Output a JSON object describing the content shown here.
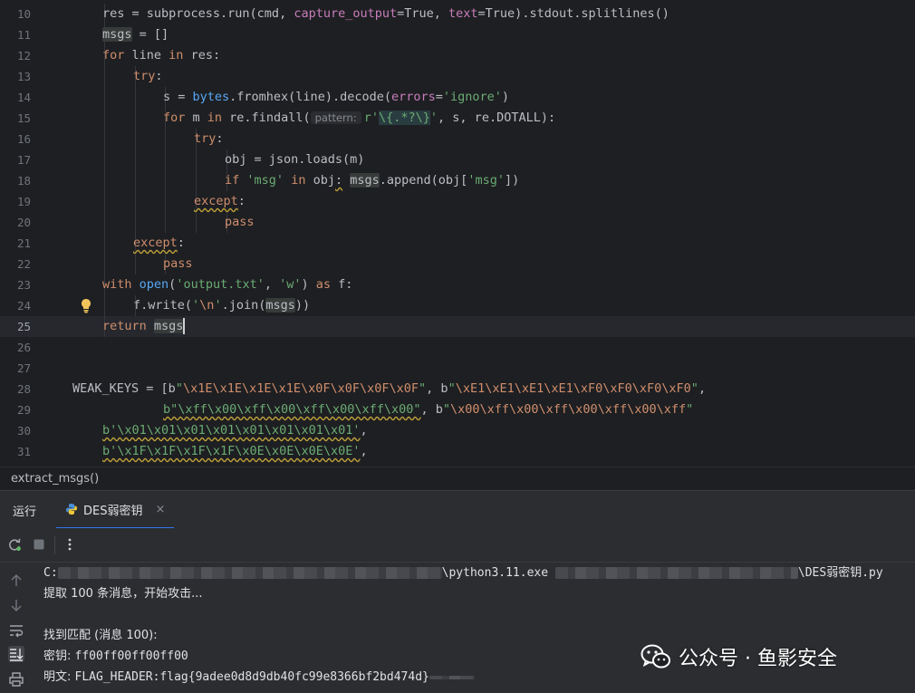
{
  "editor": {
    "lines": [
      {
        "n": "10",
        "parts": [
          [
            "",
            "res = subprocess.run(cmd, "
          ],
          [
            "param",
            "capture_output"
          ],
          [
            "",
            "=True, "
          ],
          [
            "param",
            "text"
          ],
          [
            "",
            "=True).stdout.splitlines()"
          ]
        ]
      },
      {
        "n": "11",
        "parts": [
          [
            "hl",
            "msgs"
          ],
          [
            "",
            " = []"
          ]
        ]
      },
      {
        "n": "12",
        "parts": [
          [
            "kw",
            "for"
          ],
          [
            "",
            " line "
          ],
          [
            "kw",
            "in"
          ],
          [
            "",
            " res:"
          ]
        ]
      },
      {
        "n": "13",
        "parts": [
          [
            "kw",
            "try"
          ],
          [
            "",
            ":"
          ]
        ]
      },
      {
        "n": "14",
        "parts": [
          [
            "",
            "s = "
          ],
          [
            "builtin",
            "bytes"
          ],
          [
            "",
            ".fromhex(line).decode("
          ],
          [
            "param",
            "errors"
          ],
          [
            "",
            "="
          ],
          [
            "str",
            "'ignore'"
          ],
          [
            "",
            ")"
          ]
        ]
      },
      {
        "n": "15",
        "parts": [
          [
            "kw",
            "for"
          ],
          [
            "",
            " m "
          ],
          [
            "kw",
            "in"
          ],
          [
            "",
            " re.findall("
          ],
          [
            "hint",
            "pattern:"
          ],
          [
            "str",
            "r'"
          ],
          [
            "rx",
            "\\{.*?\\}"
          ],
          [
            "str",
            "'"
          ],
          [
            "",
            ", s, re.DOTALL):"
          ]
        ]
      },
      {
        "n": "16",
        "parts": [
          [
            "kw",
            "try"
          ],
          [
            "",
            ":"
          ]
        ]
      },
      {
        "n": "17",
        "parts": [
          [
            "",
            "obj = json.loads(m)"
          ]
        ]
      },
      {
        "n": "18",
        "parts": [
          [
            "kw",
            "if"
          ],
          [
            "",
            " "
          ],
          [
            "str",
            "'msg'"
          ],
          [
            "",
            " "
          ],
          [
            "kw",
            "in"
          ],
          [
            "",
            " obj"
          ],
          [
            "underl",
            ":"
          ],
          [
            "",
            " "
          ],
          [
            "hl",
            "msgs"
          ],
          [
            "",
            ".append(obj["
          ],
          [
            "str",
            "'msg'"
          ],
          [
            "",
            "])"
          ]
        ]
      },
      {
        "n": "19",
        "parts": [
          [
            "kwu",
            "except"
          ],
          [
            "",
            ":"
          ]
        ]
      },
      {
        "n": "20",
        "parts": [
          [
            "kw",
            "pass"
          ]
        ]
      },
      {
        "n": "21",
        "parts": [
          [
            "kwu",
            "except"
          ],
          [
            "",
            ":"
          ]
        ]
      },
      {
        "n": "22",
        "parts": [
          [
            "kw",
            "pass"
          ]
        ]
      },
      {
        "n": "23",
        "parts": [
          [
            "kw",
            "with"
          ],
          [
            "",
            " "
          ],
          [
            "builtin",
            "open"
          ],
          [
            "",
            "("
          ],
          [
            "str",
            "'output.txt'"
          ],
          [
            "",
            ", "
          ],
          [
            "str",
            "'w'"
          ],
          [
            "",
            ") "
          ],
          [
            "kw",
            "as"
          ],
          [
            "",
            " f:"
          ]
        ]
      },
      {
        "n": "24",
        "parts": [
          [
            "",
            "f.write("
          ],
          [
            "str",
            "'"
          ],
          [
            "esc",
            "\\n"
          ],
          [
            "str",
            "'"
          ],
          [
            "",
            ".join("
          ],
          [
            "hl",
            "msgs"
          ],
          [
            "",
            "))"
          ]
        ]
      },
      {
        "n": "25",
        "parts": [
          [
            "kw",
            "return"
          ],
          [
            "",
            " "
          ],
          [
            "hl",
            "msgs"
          ]
        ]
      },
      {
        "n": "26",
        "parts": []
      },
      {
        "n": "27",
        "parts": []
      },
      {
        "n": "28",
        "parts": [
          [
            "",
            "WEAK_KEYS = [b"
          ],
          [
            "str",
            "\""
          ],
          [
            "esc",
            "\\x1E\\x1E\\x1E\\x1E\\x0F\\x0F\\x0F\\x0F"
          ],
          [
            "str",
            "\""
          ],
          [
            "",
            ", b"
          ],
          [
            "str",
            "\""
          ],
          [
            "esc",
            "\\xE1\\xE1\\xE1\\xE1\\xF0\\xF0\\xF0\\xF0"
          ],
          [
            "str",
            "\""
          ],
          [
            "",
            ","
          ]
        ]
      },
      {
        "n": "29",
        "parts": [
          [
            "stru",
            "b\"\\xff\\x00\\xff\\x00\\xff\\x00\\xff\\x00\""
          ],
          [
            "",
            ", b"
          ],
          [
            "str",
            "\""
          ],
          [
            "esc",
            "\\x00\\xff\\x00\\xff\\x00\\xff\\x00\\xff"
          ],
          [
            "str",
            "\""
          ]
        ]
      },
      {
        "n": "30",
        "parts": [
          [
            "stru",
            "b'\\x01\\x01\\x01\\x01\\x01\\x01\\x01\\x01'"
          ],
          [
            "",
            ","
          ]
        ]
      },
      {
        "n": "31",
        "parts": [
          [
            "stru",
            "b'\\x1F\\x1F\\x1F\\x1F\\x0E\\x0E\\x0E\\x0E'"
          ],
          [
            "",
            ","
          ]
        ]
      }
    ]
  },
  "breadcrumb": "extract_msgs()",
  "run_panel": {
    "title": "运行",
    "tab_label": "DES弱密钥",
    "close_glyph": "×"
  },
  "console": {
    "line1_prefix": "C:",
    "line1_mid": "\\python3.11.exe",
    "line1_end": "\\DES弱密钥.py",
    "line2": "提取 100 条消息，开始攻击...",
    "line3": "找到匹配 (消息 100):",
    "line4_label": "密钥: ",
    "line4_value": "ff00ff00ff00ff00",
    "line5_label": "明文: ",
    "line5_value": "FLAG_HEADER:flag{9adee0d8d9db40fc99e8366bf2bd474d}"
  },
  "watermark": "公众号 · 鱼影安全"
}
